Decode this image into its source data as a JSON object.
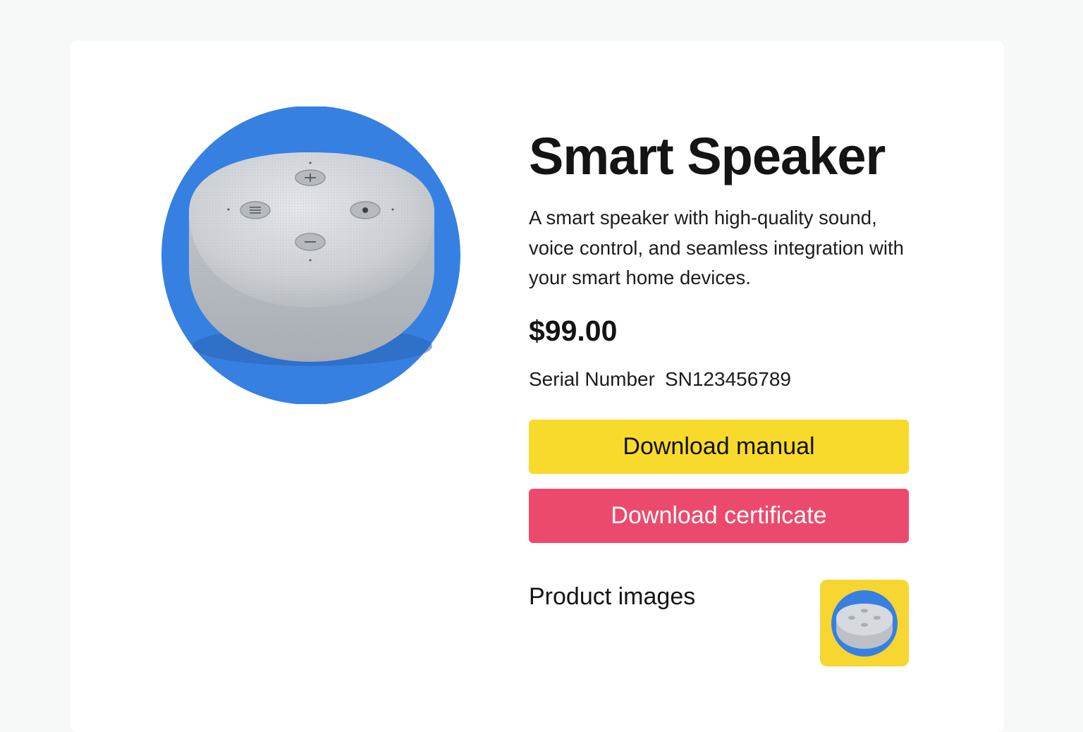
{
  "product": {
    "title": "Smart Speaker",
    "description": "A smart speaker with high-quality sound, voice control, and seamless integration with your smart home devices.",
    "price": "$99.00",
    "serial_label": "Serial Number",
    "serial_value": "SN123456789"
  },
  "actions": {
    "download_manual_label": "Download manual",
    "download_certificate_label": "Download certificate"
  },
  "gallery": {
    "label": "Product images",
    "thumbnails": [
      {
        "icon": "smart-speaker-thumbnail"
      }
    ]
  },
  "colors": {
    "hero_circle": "#3680e2",
    "manual_button": "#f8da2c",
    "certificate_button": "#ec4a6d",
    "thumbnail_background": "#f7d632"
  }
}
